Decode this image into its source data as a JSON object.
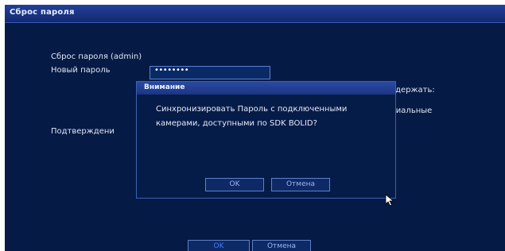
{
  "window": {
    "title": "Сброс пароля"
  },
  "form": {
    "heading": "Сброс пароля (admin)",
    "new_password_label": "Новый пароль",
    "new_password_value": "••••••••",
    "confirm_label": "Подтверждени",
    "hint_line1": "одержать:",
    "hint_line2": "циальные"
  },
  "dialog": {
    "title": "Внимание",
    "message": "Синхронизировать Пароль с подключенными камерами, доступными по SDK BOLID?",
    "ok_label": "OK",
    "cancel_label": "Отмена"
  },
  "footer": {
    "ok_label": "OK",
    "cancel_label": "Отмена"
  }
}
